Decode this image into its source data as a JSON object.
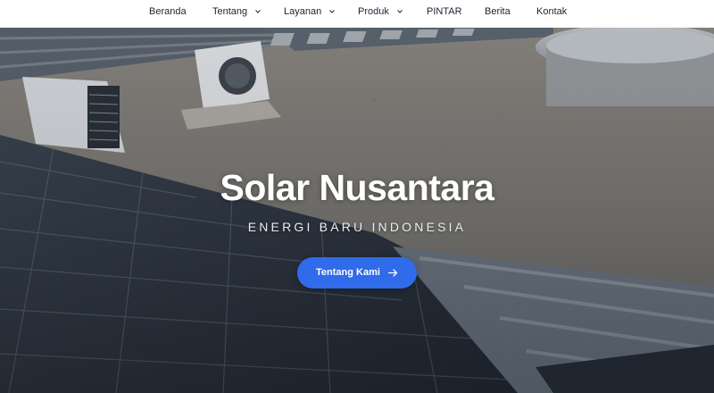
{
  "nav": {
    "items": [
      {
        "label": "Beranda",
        "has_dropdown": false
      },
      {
        "label": "Tentang",
        "has_dropdown": true
      },
      {
        "label": "Layanan",
        "has_dropdown": true
      },
      {
        "label": "Produk",
        "has_dropdown": true
      },
      {
        "label": "PINTAR",
        "has_dropdown": false
      },
      {
        "label": "Berita",
        "has_dropdown": false
      },
      {
        "label": "Kontak",
        "has_dropdown": false
      }
    ],
    "dropdown_icon": "chevron-down-icon"
  },
  "hero": {
    "title": "Solar Nusantara",
    "subtitle": "ENERGI BARU INDONESIA",
    "cta_label": "Tentang Kami",
    "cta_icon": "arrow-right-icon",
    "background": "rooftop-solar-panels-photo"
  },
  "colors": {
    "accent": "#2f6bea",
    "nav_bg": "#ffffff",
    "nav_text": "#1f2330",
    "title_text": "#ffffff"
  }
}
